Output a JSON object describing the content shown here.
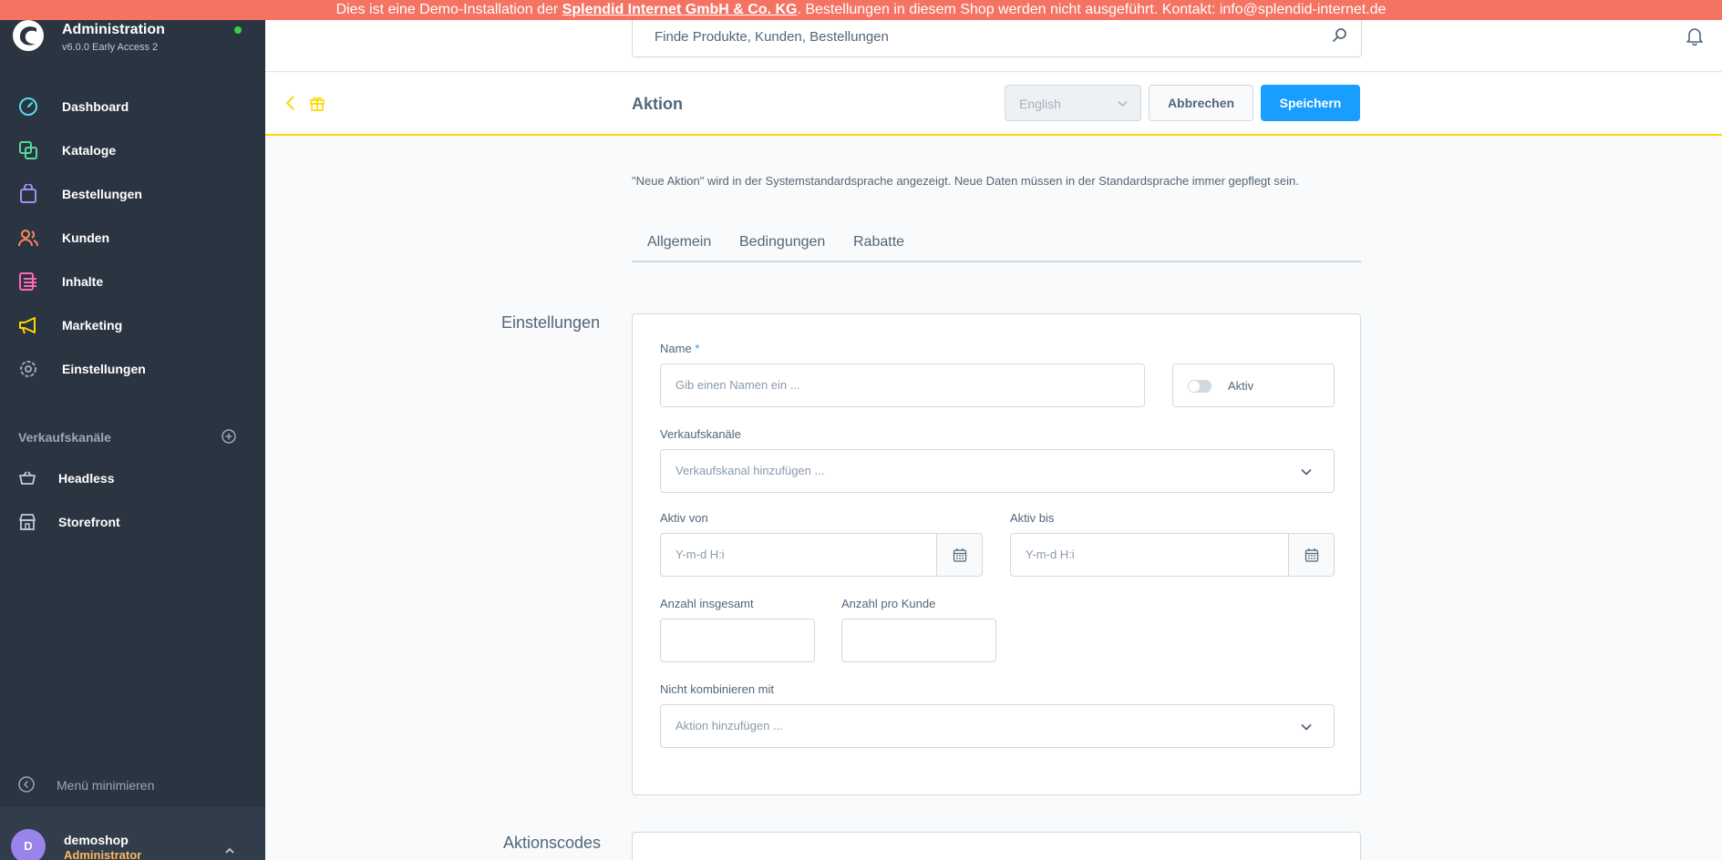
{
  "banner": {
    "prefix": "Dies ist eine Demo-Installation der ",
    "company": "Splendid Internet GmbH & Co. KG",
    "suffix": ". Bestellungen in diesem Shop werden nicht ausgeführt. Kontakt: info@splendid-internet.de"
  },
  "brand": {
    "title": "Administration",
    "version": "v6.0.0 Early Access 2"
  },
  "nav": [
    {
      "label": "Dashboard",
      "icon": "dashboard-icon",
      "color": "#57d9f4"
    },
    {
      "label": "Kataloge",
      "icon": "catalog-icon",
      "color": "#57d998"
    },
    {
      "label": "Bestellungen",
      "icon": "orders-icon",
      "color": "#a092f0"
    },
    {
      "label": "Kunden",
      "icon": "customers-icon",
      "color": "#f88962"
    },
    {
      "label": "Inhalte",
      "icon": "content-icon",
      "color": "#ff68b4"
    },
    {
      "label": "Marketing",
      "icon": "marketing-icon",
      "color": "#ffd700"
    },
    {
      "label": "Einstellungen",
      "icon": "settings-icon",
      "color": "#9aa8b5"
    }
  ],
  "channels": {
    "title": "Verkaufskanäle",
    "items": [
      {
        "label": "Headless",
        "icon": "basket-icon"
      },
      {
        "label": "Storefront",
        "icon": "storefront-icon"
      }
    ]
  },
  "minimize_label": "Menü minimieren",
  "user": {
    "initial": "D",
    "name": "demoshop",
    "role": "Administrator"
  },
  "search": {
    "placeholder": "Finde Produkte, Kunden, Bestellungen"
  },
  "smartbar": {
    "title": "Aktion",
    "language": "English",
    "cancel_label": "Abbrechen",
    "save_label": "Speichern"
  },
  "notice": "\"Neue Aktion\" wird in der Systemstandardsprache angezeigt. Neue Daten müssen in der Standardsprache immer gepflegt sein.",
  "tabs": [
    "Allgemein",
    "Bedingungen",
    "Rabatte"
  ],
  "settings": {
    "section_title": "Einstellungen",
    "name_label": "Name",
    "required_mark": "*",
    "name_placeholder": "Gib einen Namen ein ...",
    "active_label": "Aktiv",
    "active_value": false,
    "channels_label": "Verkaufskanäle",
    "channels_placeholder": "Verkaufskanal hinzufügen ...",
    "valid_from_label": "Aktiv von",
    "valid_from_placeholder": "Y-m-d H:i",
    "valid_until_label": "Aktiv bis",
    "valid_until_placeholder": "Y-m-d H:i",
    "max_total_label": "Anzahl insgesamt",
    "max_customer_label": "Anzahl pro Kunde",
    "exclusions_label": "Nicht kombinieren mit",
    "exclusions_placeholder": "Aktion hinzufügen ..."
  },
  "codes_section_title": "Aktionscodes",
  "colors": {
    "accent": "#189eff",
    "banner": "#f47363",
    "sidebar": "#2b3441",
    "smartbar_border": "#ffd700"
  }
}
